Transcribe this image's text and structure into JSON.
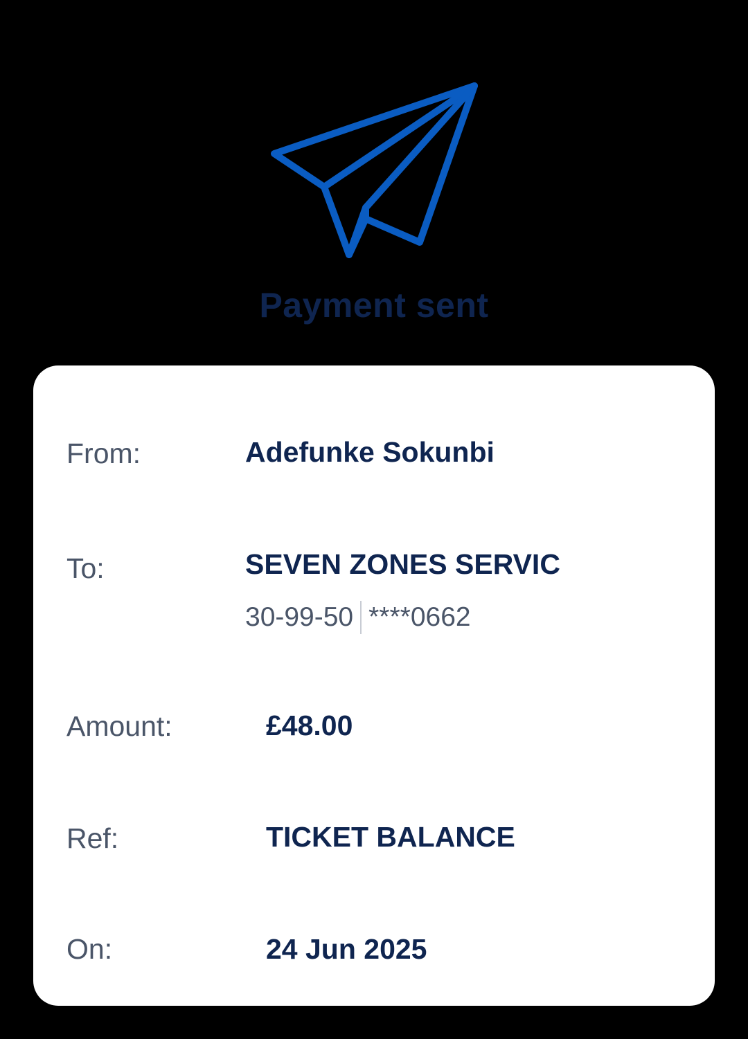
{
  "header": {
    "icon": "paper-plane-icon",
    "title": "Payment sent",
    "icon_color": "#0a5cc2",
    "title_color": "#0f2550"
  },
  "details": {
    "from": {
      "label": "From:",
      "value": "Adefunke Sokunbi"
    },
    "to": {
      "label": "To:",
      "value": "SEVEN ZONES SERVIC",
      "sort_code": "30-99-50",
      "account_number": "****0662"
    },
    "amount": {
      "label": "Amount:",
      "value": "£48.00"
    },
    "ref": {
      "label": "Ref:",
      "value": "TICKET BALANCE"
    },
    "on": {
      "label": "On:",
      "value": "24 Jun 2025"
    }
  }
}
